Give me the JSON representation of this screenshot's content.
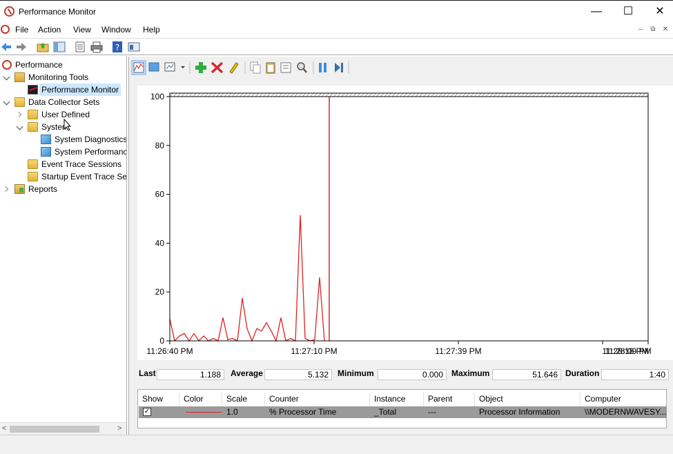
{
  "window": {
    "title": "Performance Monitor",
    "minimize": "—",
    "maximize": "☐",
    "close": "✕"
  },
  "menu": {
    "items": [
      "File",
      "Action",
      "View",
      "Window",
      "Help"
    ],
    "mdi": [
      "–",
      "⧉",
      "✕"
    ]
  },
  "tree": {
    "root": "Performance",
    "monitoring_tools": "Monitoring Tools",
    "performance_monitor": "Performance Monitor",
    "data_collector_sets": "Data Collector Sets",
    "user_defined": "User Defined",
    "system": "System",
    "system_diagnostics": "System Diagnostics",
    "system_performance": "System Performance",
    "event_trace_sessions": "Event Trace Sessions",
    "startup_event_trace": "Startup Event Trace Sessions",
    "reports": "Reports"
  },
  "chart_data": {
    "type": "line",
    "ylim": [
      0,
      100
    ],
    "yticks": [
      0,
      20,
      40,
      60,
      80,
      100
    ],
    "x_tick_labels": [
      "11:26:40 PM",
      "11:27:10 PM",
      "11:27:39 PM",
      "11:28:09 PM",
      "11:28:18 PM"
    ],
    "series": [
      {
        "color": "#e02020",
        "values": [
          9,
          0,
          2,
          3,
          0,
          3,
          0,
          2,
          0,
          1,
          0,
          9.5,
          0.5,
          1,
          0,
          17.5,
          5,
          0,
          5,
          4,
          7.5,
          4,
          0,
          9.5,
          0,
          1,
          0,
          51.5,
          1,
          0,
          0.5,
          26,
          0
        ],
        "cursor_index": 33
      }
    ],
    "points_visible": 33,
    "points_total": 100
  },
  "stats": {
    "last_label": "Last",
    "last": "1.188",
    "average_label": "Average",
    "average": "5.132",
    "minimum_label": "Minimum",
    "minimum": "0.000",
    "maximum_label": "Maximum",
    "maximum": "51.646",
    "duration_label": "Duration",
    "duration": "1:40"
  },
  "counters": {
    "headers": [
      "Show",
      "Color",
      "Scale",
      "Counter",
      "Instance",
      "Parent",
      "Object",
      "Computer"
    ],
    "rows": [
      {
        "show": "✓",
        "scale": "1.0",
        "counter": "% Processor Time",
        "instance": "_Total",
        "parent": "---",
        "object": "Processor Information",
        "computer": "\\\\MODERNWAVESY..."
      }
    ]
  },
  "colors": {
    "series_red": "#e02020",
    "selection": "#cce8ff",
    "row_selected": "#9a9a9a"
  }
}
